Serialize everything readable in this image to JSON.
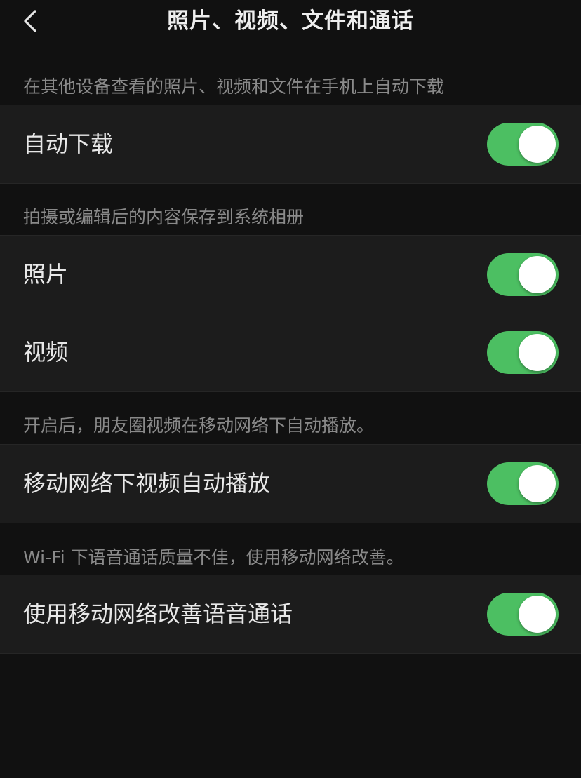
{
  "header": {
    "title": "照片、视频、文件和通话",
    "back_icon": "chevron-left-icon"
  },
  "sections": [
    {
      "header": "在其他设备查看的照片、视频和文件在手机上自动下载",
      "rows": [
        {
          "label": "自动下载",
          "enabled": true
        }
      ]
    },
    {
      "header": "拍摄或编辑后的内容保存到系统相册",
      "rows": [
        {
          "label": "照片",
          "enabled": true
        },
        {
          "label": "视频",
          "enabled": true
        }
      ]
    },
    {
      "header": "开启后，朋友圈视频在移动网络下自动播放。",
      "rows": [
        {
          "label": "移动网络下视频自动播放",
          "enabled": true
        }
      ]
    },
    {
      "header": "Wi-Fi 下语音通话质量不佳，使用移动网络改善。",
      "rows": [
        {
          "label": "使用移动网络改善语音通话",
          "enabled": true
        }
      ]
    }
  ],
  "colors": {
    "background": "#111111",
    "row_background": "#1c1c1c",
    "toggle_on": "#4cbf62",
    "section_text": "#8a8a8a"
  }
}
